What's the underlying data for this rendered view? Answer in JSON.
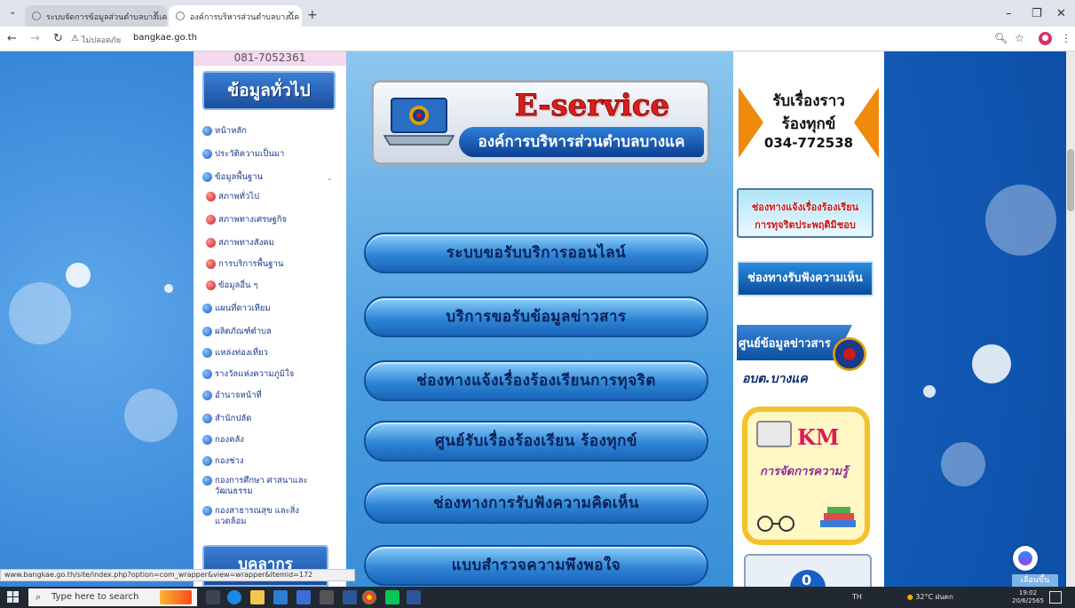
{
  "browser": {
    "tabs": [
      {
        "label": "ระบบจัดการข้อมูลส่วนตำบลบางแค",
        "active": false
      },
      {
        "label": "องค์การบริหารส่วนตำบลบางแค จังห",
        "active": true
      }
    ],
    "url_warning": "ไม่ปลอดภัย",
    "url": "bangkae.go.th",
    "status_url": "www.bangkae.go.th/site/index.php?option=com_wrapper&view=wrapper&Itemid=172"
  },
  "site": {
    "top_phone": "081-7052361",
    "sidebar": {
      "heading": "ข้อมูลทั่วไป",
      "items": [
        {
          "label": "หน้าหลัก",
          "sub": false
        },
        {
          "label": "ประวัติความเป็นมา",
          "sub": false
        },
        {
          "label": "ข้อมูลพื้นฐาน",
          "sub": false
        },
        {
          "label": "สภาพทั่วไป",
          "sub": true
        },
        {
          "label": "สภาพทางเศรษฐกิจ",
          "sub": true
        },
        {
          "label": "สภาพทางสังคม",
          "sub": true
        },
        {
          "label": "การบริการพื้นฐาน",
          "sub": true
        },
        {
          "label": "ข้อมูลอื่น ๆ",
          "sub": true
        },
        {
          "label": "แผนที่ดาวเทียม",
          "sub": false
        },
        {
          "label": "ผลิตภัณฑ์ตำบล",
          "sub": false
        },
        {
          "label": "แหล่งท่องเที่ยว",
          "sub": false
        },
        {
          "label": "รางวัลแห่งความภูมิใจ",
          "sub": false
        },
        {
          "label": "อำนาจหน้าที่",
          "sub": false
        },
        {
          "label": "สำนักปลัด",
          "sub": false
        },
        {
          "label": "กองคลัง",
          "sub": false
        },
        {
          "label": "กองช่าง",
          "sub": false
        },
        {
          "label": "กองการศึกษา ศาสนาและวัฒนธรรม",
          "sub": false
        },
        {
          "label": "กองสาธารณสุข และสิ่งแวดล้อม",
          "sub": false
        }
      ],
      "bottom_heading": "บุคลากร"
    },
    "eservice": {
      "title": "E-service",
      "subtitle": "องค์การบริหารส่วนตำบลบางแค"
    },
    "main_buttons": [
      "ระบบขอรับบริการออนไลน์",
      "บริการขอรับข้อมูลข่าวสาร",
      "ช่องทางแจ้งเรื่องร้องเรียนการทุจริต",
      "ศูนย์รับเรื่องร้องเรียน ร้องทุกข์",
      "ช่องทางการรับฟังความคิดเห็น",
      "แบบสำรวจความพึงพอใจ"
    ],
    "right": {
      "complaint_line1": "รับเรื่องราว",
      "complaint_line2": "ร้องทุกข์",
      "complaint_phone": "034-772538",
      "corruption_line1": "ช่องทางแจ้งเรื่องร้องเรียน",
      "corruption_line2": "การทุจริตประพฤติมิชอบ",
      "opinion": "ช่องทางรับฟังความเห็น",
      "infocenter": "ศูนย์ข้อมูลข่าวสาร",
      "infocenter_abbr": "อบต.บางแค",
      "km_title": "KM",
      "km_sub": "การจัดการความรู้",
      "bottom_digit": "0"
    },
    "scroll_top": "เลื่อนขึ้น"
  },
  "taskbar": {
    "search_placeholder": "Type here to search",
    "tray_text": "TH",
    "weather": "32°C ฝนตก",
    "time": "19:02",
    "date": "20/6/2565"
  },
  "colors": {
    "page_bg": "#1f6fcc",
    "button_text": "#0a2158",
    "accent_red": "#d91e1e"
  }
}
